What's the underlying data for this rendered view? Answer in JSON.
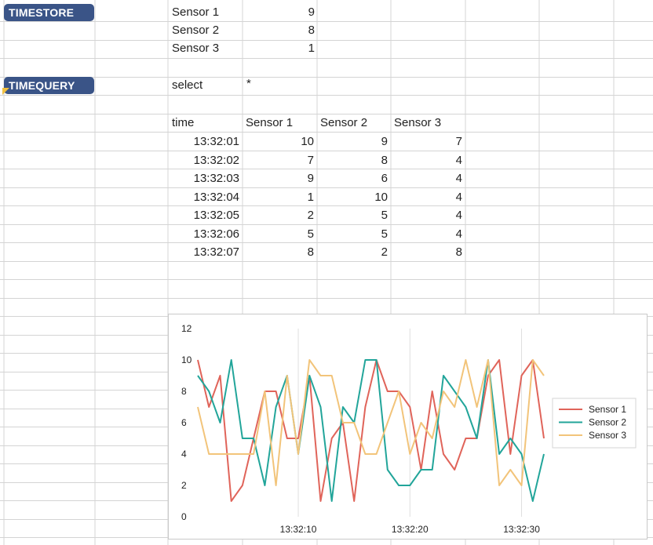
{
  "timestore": {
    "label": "TIMESTORE",
    "rows": [
      {
        "name": "Sensor 1",
        "value": "9"
      },
      {
        "name": "Sensor 2",
        "value": "8"
      },
      {
        "name": "Sensor 3",
        "value": "1"
      }
    ]
  },
  "timequery": {
    "label": "TIMEQUERY",
    "keyword": "select",
    "arg": "*"
  },
  "results": {
    "headers": [
      "time",
      "Sensor 1",
      "Sensor 2",
      "Sensor 3"
    ],
    "rows": [
      [
        "13:32:01",
        "10",
        "9",
        "7"
      ],
      [
        "13:32:02",
        "7",
        "8",
        "4"
      ],
      [
        "13:32:03",
        "9",
        "6",
        "4"
      ],
      [
        "13:32:04",
        "1",
        "10",
        "4"
      ],
      [
        "13:32:05",
        "2",
        "5",
        "4"
      ],
      [
        "13:32:06",
        "5",
        "5",
        "4"
      ],
      [
        "13:32:07",
        "8",
        "2",
        "8"
      ]
    ]
  },
  "colors": {
    "badge": "#3a5487",
    "grid": "#d4d4d4",
    "sensor1": "#e0645a",
    "sensor2": "#22a59a",
    "sensor3": "#f2c47a"
  },
  "chart_data": {
    "type": "line",
    "x": [
      "13:32:01",
      "13:32:02",
      "13:32:03",
      "13:32:04",
      "13:32:05",
      "13:32:06",
      "13:32:07",
      "13:32:08",
      "13:32:09",
      "13:32:10",
      "13:32:11",
      "13:32:12",
      "13:32:13",
      "13:32:14",
      "13:32:15",
      "13:32:16",
      "13:32:17",
      "13:32:18",
      "13:32:19",
      "13:32:20",
      "13:32:21",
      "13:32:22",
      "13:32:23",
      "13:32:24",
      "13:32:25",
      "13:32:26",
      "13:32:27",
      "13:32:28",
      "13:32:29",
      "13:32:30",
      "13:32:31",
      "13:32:32"
    ],
    "xticks": [
      "13:32:10",
      "13:32:20",
      "13:32:30"
    ],
    "series": [
      {
        "name": "Sensor 1",
        "color": "#e0645a",
        "values": [
          10,
          7,
          9,
          1,
          2,
          5,
          8,
          8,
          5,
          5,
          9,
          1,
          5,
          6,
          1,
          7,
          10,
          8,
          8,
          7,
          3,
          8,
          4,
          3,
          5,
          5,
          9,
          10,
          4,
          9,
          10,
          5
        ]
      },
      {
        "name": "Sensor 2",
        "color": "#22a59a",
        "values": [
          9,
          8,
          6,
          10,
          5,
          5,
          2,
          7,
          9,
          4,
          9,
          7,
          1,
          7,
          6,
          10,
          10,
          3,
          2,
          2,
          3,
          3,
          9,
          8,
          7,
          5,
          10,
          4,
          5,
          4,
          1,
          4
        ]
      },
      {
        "name": "Sensor 3",
        "color": "#f2c47a",
        "values": [
          7,
          4,
          4,
          4,
          4,
          4,
          8,
          2,
          9,
          4,
          10,
          9,
          9,
          6,
          6,
          4,
          4,
          6,
          8,
          4,
          6,
          5,
          8,
          7,
          10,
          7,
          10,
          2,
          3,
          2,
          10,
          9
        ]
      }
    ],
    "ylim": [
      0,
      12
    ],
    "yticks": [
      "0",
      "2",
      "4",
      "6",
      "8",
      "10",
      "12"
    ],
    "grid": "vertical",
    "legend": "right"
  }
}
